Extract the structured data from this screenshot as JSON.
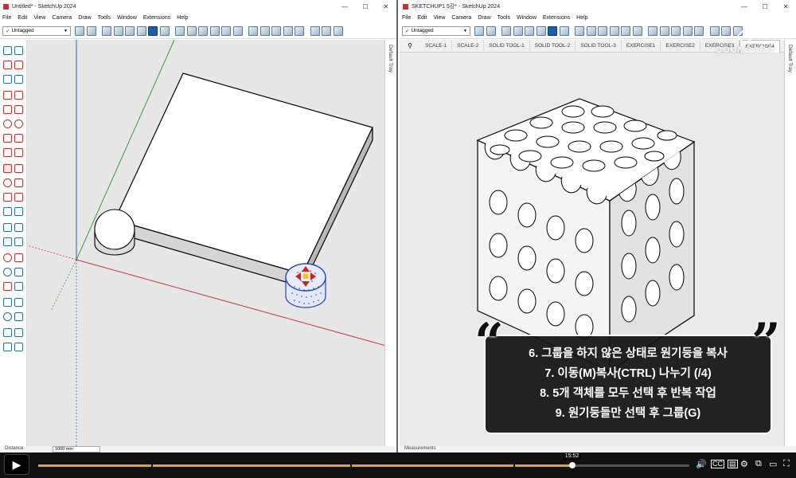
{
  "left_window": {
    "title": "Untitled* - SketchUp 2024",
    "menu": [
      "File",
      "Edit",
      "View",
      "Camera",
      "Draw",
      "Tools",
      "Window",
      "Extensions",
      "Help"
    ],
    "tag_selector": "Untagged",
    "tray_label": "Default Tray",
    "status_label": "Distance",
    "measurement_value": "1000 mm"
  },
  "right_window": {
    "title": "SKETCHUP1 5강* - SketchUp 2024",
    "menu": [
      "File",
      "Edit",
      "View",
      "Camera",
      "Draw",
      "Tools",
      "Window",
      "Extensions",
      "Help"
    ],
    "tag_selector": "Untagged",
    "tray_label": "Default Tray",
    "scene_tabs": [
      "SCALE-1",
      "SCALE-2",
      "SOLID TOOL-1",
      "SOLID TOOL-2",
      "SOLID TOOL-3",
      "EXERCISE1",
      "EXERCISE2",
      "EXERCISE3",
      "EXERCISE4"
    ],
    "active_tab": "EXERCISE4",
    "status_label": "Measurements"
  },
  "watermark": "COUMSARA",
  "subtitle": {
    "lines": [
      "6. 그룹을 하지 않은 상태로 원기둥을 복사",
      "7. 이동(M)복사(CTRL) 나누기 (/4)",
      "8. 5개 객체를 모두 선택 후 반복 작업",
      "9. 원기둥들만 선택 후 그룹(G)"
    ]
  },
  "video": {
    "current_time": "15:52",
    "progress_fraction": 0.82,
    "controls": [
      "volume-icon",
      "captions-icon",
      "subtitles-icon",
      "settings-icon",
      "miniplayer-icon",
      "theater-icon",
      "fullscreen-icon"
    ]
  },
  "colors": {
    "accent_progress": "#e8a032",
    "axis_red": "#c83232",
    "axis_green": "#3a9a3a",
    "axis_blue": "#3060c0",
    "selection_blue": "#1f3fd0"
  }
}
